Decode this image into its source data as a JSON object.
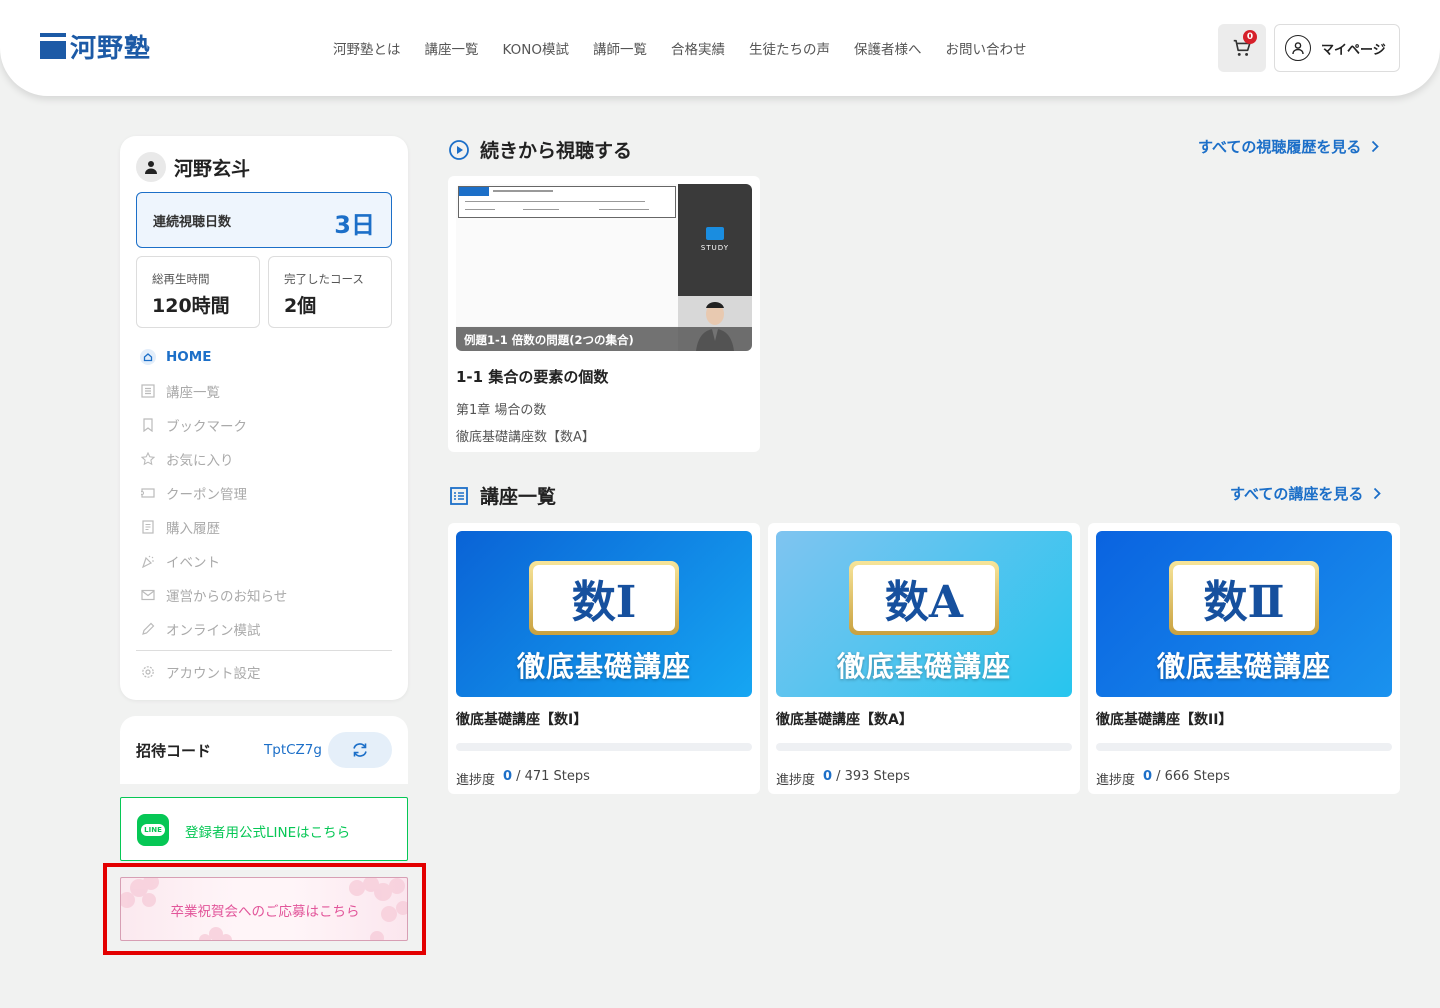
{
  "header": {
    "logo_text": "河野塾",
    "nav": [
      "河野塾とは",
      "講座一覧",
      "KONO模試",
      "講師一覧",
      "合格実績",
      "生徒たちの声",
      "保護者様へ",
      "お問い合わせ"
    ],
    "cart_count": "0",
    "mypage_label": "マイページ"
  },
  "sidebar": {
    "user_name": "河野玄斗",
    "streak": {
      "label": "連続視聴日数",
      "value": "3日"
    },
    "stats": [
      {
        "label": "総再生時間",
        "value": "120時間"
      },
      {
        "label": "完了したコース",
        "value": "2個"
      }
    ],
    "menu": [
      {
        "label": "HOME",
        "icon": "home-icon",
        "active": true
      },
      {
        "label": "講座一覧",
        "icon": "list-icon"
      },
      {
        "label": "ブックマーク",
        "icon": "bookmark-icon"
      },
      {
        "label": "お気に入り",
        "icon": "star-icon"
      },
      {
        "label": "クーポン管理",
        "icon": "coupon-icon"
      },
      {
        "label": "購入履歴",
        "icon": "receipt-icon"
      },
      {
        "label": "イベント",
        "icon": "party-icon"
      },
      {
        "label": "運営からのお知らせ",
        "icon": "mail-icon"
      },
      {
        "label": "オンライン模試",
        "icon": "pencil-icon"
      }
    ],
    "account_settings": "アカウント設定",
    "invite": {
      "label": "招待コード",
      "code": "TptCZ7g"
    },
    "line_button": {
      "logo": "LINE",
      "label": "登録者用公式LINEはこちら"
    },
    "sakura_button": {
      "label": "卒業祝賀会へのご応募はこちら"
    }
  },
  "continue": {
    "title": "続きから視聴する",
    "see_all": "すべての視聴履歴を見る",
    "thumb_caption": "例題1-1 倍数の問題(2つの集合)",
    "thumb_brand": "STUDY",
    "lesson_title": "1-1 集合の要素の個数",
    "chapter": "第1章 場合の数",
    "course": "徹底基礎講座数【数A】"
  },
  "courses": {
    "title": "講座一覧",
    "see_all": "すべての講座を見る",
    "progress_label": "進捗度",
    "items": [
      {
        "badge": "数Ⅰ",
        "subtitle": "徹底基礎講座",
        "name": "徹底基礎講座【数I】",
        "done": "0",
        "total": "/ 471 Steps",
        "progress": 0
      },
      {
        "badge": "数A",
        "subtitle": "徹底基礎講座",
        "name": "徹底基礎講座【数A】",
        "done": "0",
        "total": "/ 393 Steps",
        "progress": 0
      },
      {
        "badge": "数Ⅱ",
        "subtitle": "徹底基礎講座",
        "name": "徹底基礎講座【数II】",
        "done": "0",
        "total": "/ 666 Steps",
        "progress": 0
      }
    ]
  },
  "colors": {
    "accent": "#1c6fc8",
    "line": "#06c755",
    "sakura": "#e2559a",
    "highlight": "#e30000"
  }
}
